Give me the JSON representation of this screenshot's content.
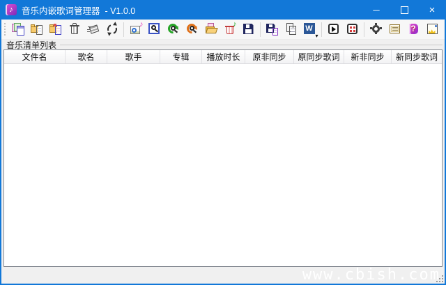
{
  "window": {
    "title": "音乐内嵌歌词管理器  - V1.0.0",
    "controls": {
      "minimize": "─",
      "close": "×"
    }
  },
  "colors": {
    "titlebar": "#1278d8",
    "window_border": "#1278d8",
    "toolbar_bg": "#f7f7f7",
    "client_bg": "#f0f0f0",
    "table_border": "#828790",
    "watermark": "#ffffff"
  },
  "glyphs": {
    "note": "♪",
    "word": "W",
    "dropdown": "▾",
    "question": "?"
  },
  "toolbar": {
    "icons": [
      "add-files",
      "paste-folder",
      "import-folder",
      "delete",
      "clear-list",
      "refresh",
      "music-settings",
      "search",
      "search-sync-green",
      "search-sync-orange",
      "open-folder",
      "delete-lyrics",
      "save",
      "save-list",
      "copy-list",
      "word-export",
      "play",
      "batch-dots",
      "settings",
      "license",
      "help",
      "about"
    ]
  },
  "group": {
    "label": "音乐清单列表"
  },
  "table": {
    "columns": [
      "文件名",
      "歌名",
      "歌手",
      "专辑",
      "播放时长",
      "原非同步",
      "原同步歌词",
      "新非同步",
      "新同步歌词"
    ],
    "rows": []
  },
  "watermark": "www.cbish.com"
}
